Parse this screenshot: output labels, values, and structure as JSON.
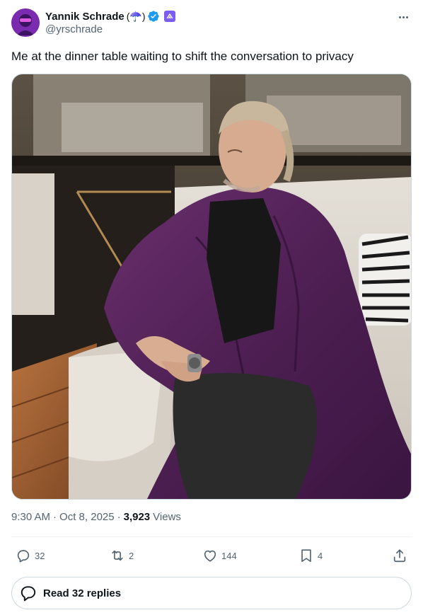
{
  "author": {
    "display_name": "Yannik Schrade",
    "name_emoji": "(☂️)",
    "handle": "@yrschrade",
    "avatar_icon": "profile-avatar",
    "verified_color": "#1d9bf0",
    "affiliate_badge_color": "#7b5cf5"
  },
  "post": {
    "text": "Me at the dinner table waiting to shift the conversation to privacy",
    "media_description_icon": "photo",
    "time": "9:30 AM",
    "date": "Oct 8, 2025",
    "views_count": "3,923",
    "views_label": "Views"
  },
  "actions": {
    "reply_count": "32",
    "repost_count": "2",
    "like_count": "144",
    "bookmark_count": "4",
    "icons": [
      "reply-icon",
      "repost-icon",
      "like-icon",
      "bookmark-icon",
      "share-icon"
    ]
  },
  "read_replies": {
    "label": "Read 32 replies"
  },
  "colors": {
    "text_primary": "#0f1419",
    "text_secondary": "#536471",
    "border": "#cfd9de",
    "accent": "#1d9bf0"
  }
}
